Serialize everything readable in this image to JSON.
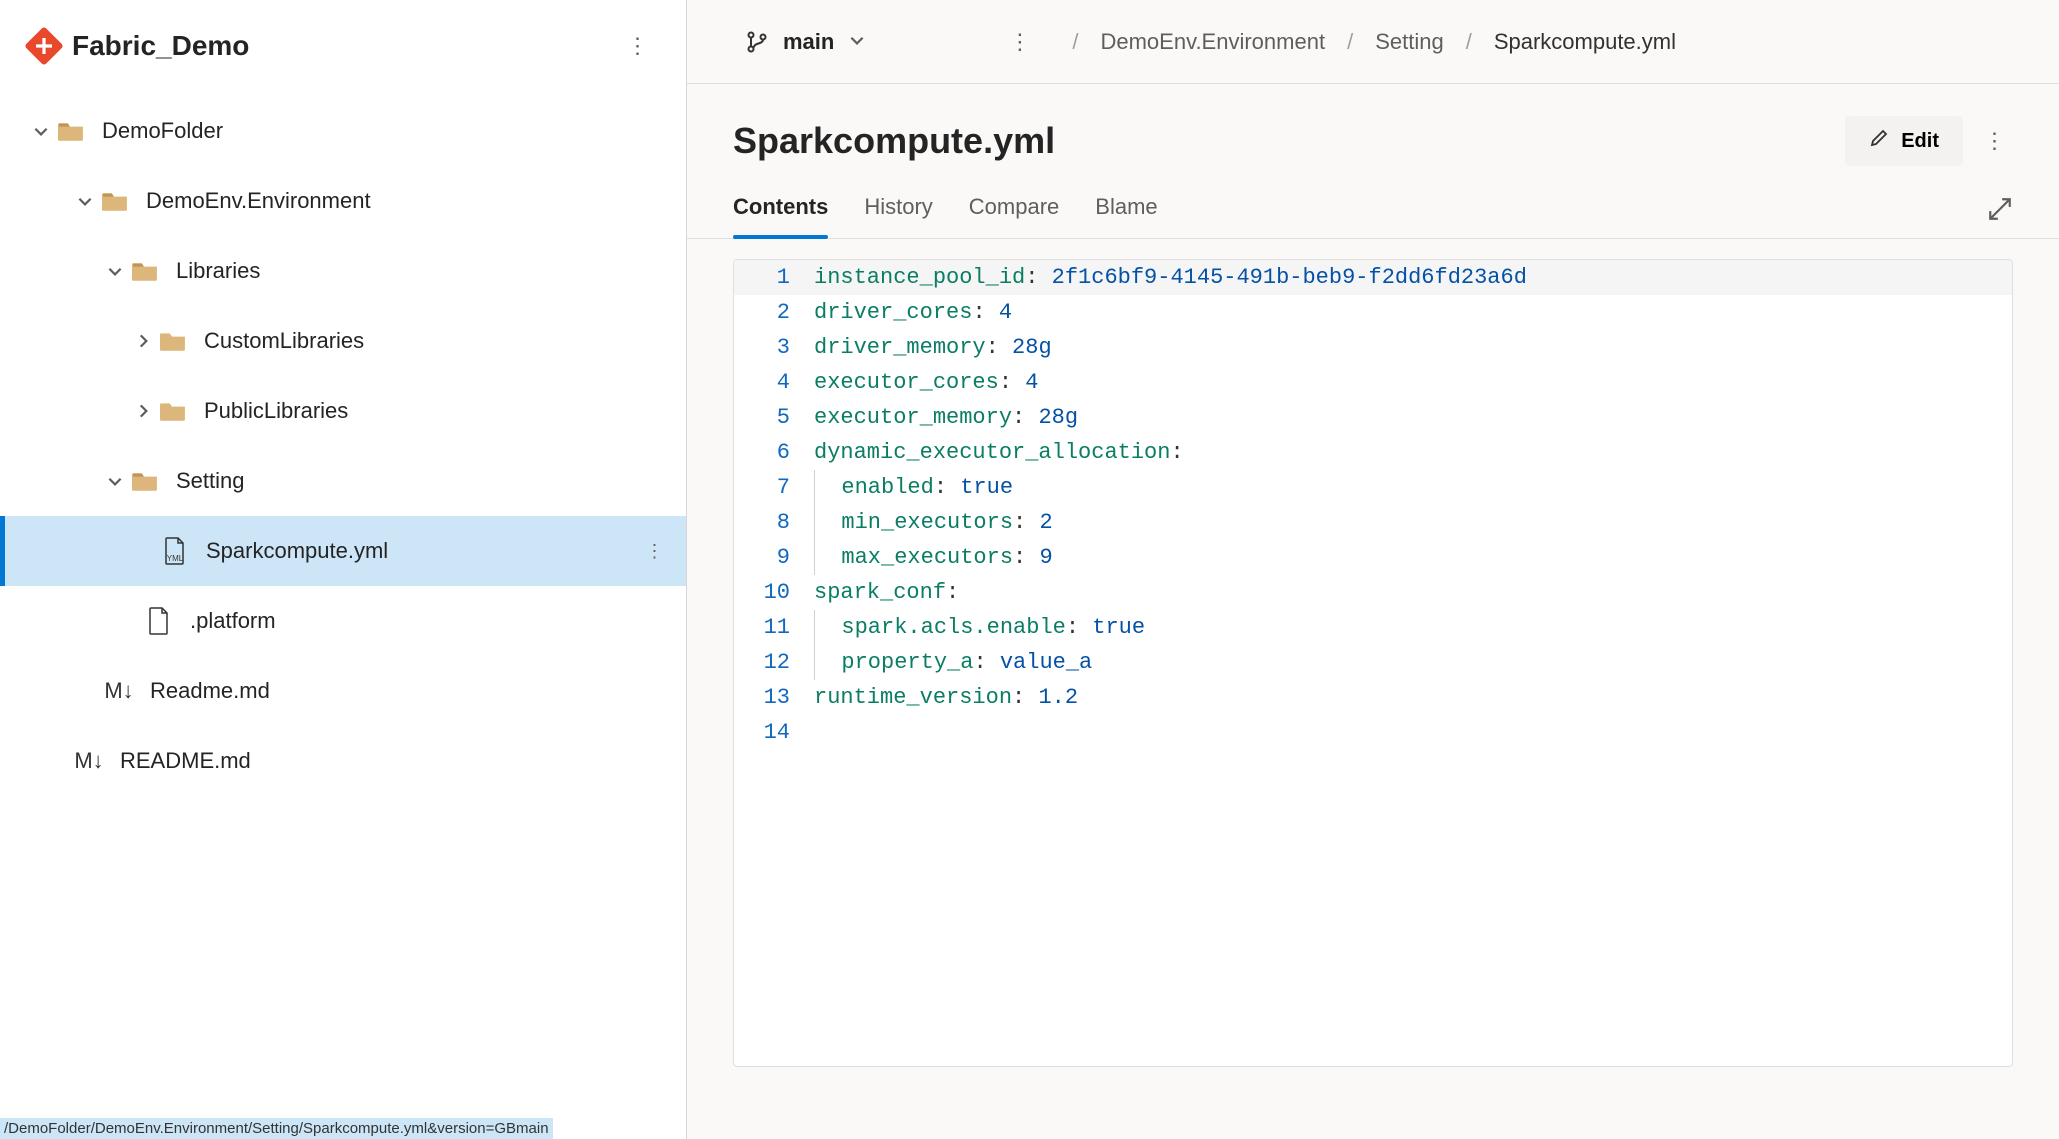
{
  "repo": {
    "name": "Fabric_Demo"
  },
  "tree": {
    "root": {
      "label": "DemoFolder"
    },
    "env": {
      "label": "DemoEnv.Environment"
    },
    "libraries": {
      "label": "Libraries"
    },
    "custom": {
      "label": "CustomLibraries"
    },
    "public": {
      "label": "PublicLibraries"
    },
    "setting": {
      "label": "Setting"
    },
    "sparkcompute": {
      "label": "Sparkcompute.yml"
    },
    "platform": {
      "label": ".platform"
    },
    "readme_inner": {
      "label": "Readme.md"
    },
    "readme_root": {
      "label": "README.md"
    }
  },
  "branch": {
    "name": "main"
  },
  "breadcrumbs": {
    "0": "DemoEnv.Environment",
    "1": "Setting",
    "2": "Sparkcompute.yml"
  },
  "file": {
    "title": "Sparkcompute.yml"
  },
  "actions": {
    "edit": "Edit"
  },
  "tabs": {
    "contents": "Contents",
    "history": "History",
    "compare": "Compare",
    "blame": "Blame"
  },
  "code": {
    "lines": [
      {
        "n": "1",
        "tokens": [
          {
            "t": "key",
            "v": "instance_pool_id"
          },
          {
            "t": "sep",
            "v": ": "
          },
          {
            "t": "val",
            "v": "2f1c6bf9-4145-491b-beb9-f2dd6fd23a6d"
          }
        ]
      },
      {
        "n": "2",
        "tokens": [
          {
            "t": "key",
            "v": "driver_cores"
          },
          {
            "t": "sep",
            "v": ": "
          },
          {
            "t": "val",
            "v": "4"
          }
        ]
      },
      {
        "n": "3",
        "tokens": [
          {
            "t": "key",
            "v": "driver_memory"
          },
          {
            "t": "sep",
            "v": ": "
          },
          {
            "t": "val",
            "v": "28g"
          }
        ]
      },
      {
        "n": "4",
        "tokens": [
          {
            "t": "key",
            "v": "executor_cores"
          },
          {
            "t": "sep",
            "v": ": "
          },
          {
            "t": "val",
            "v": "4"
          }
        ]
      },
      {
        "n": "5",
        "tokens": [
          {
            "t": "key",
            "v": "executor_memory"
          },
          {
            "t": "sep",
            "v": ": "
          },
          {
            "t": "val",
            "v": "28g"
          }
        ]
      },
      {
        "n": "6",
        "tokens": [
          {
            "t": "key",
            "v": "dynamic_executor_allocation"
          },
          {
            "t": "sep",
            "v": ":"
          }
        ]
      },
      {
        "n": "7",
        "indent": 1,
        "tokens": [
          {
            "t": "key",
            "v": "enabled"
          },
          {
            "t": "sep",
            "v": ": "
          },
          {
            "t": "val",
            "v": "true"
          }
        ]
      },
      {
        "n": "8",
        "indent": 1,
        "tokens": [
          {
            "t": "key",
            "v": "min_executors"
          },
          {
            "t": "sep",
            "v": ": "
          },
          {
            "t": "val",
            "v": "2"
          }
        ]
      },
      {
        "n": "9",
        "indent": 1,
        "tokens": [
          {
            "t": "key",
            "v": "max_executors"
          },
          {
            "t": "sep",
            "v": ": "
          },
          {
            "t": "val",
            "v": "9"
          }
        ]
      },
      {
        "n": "10",
        "tokens": [
          {
            "t": "key",
            "v": "spark_conf"
          },
          {
            "t": "sep",
            "v": ":"
          }
        ]
      },
      {
        "n": "11",
        "indent": 1,
        "tokens": [
          {
            "t": "key",
            "v": "spark.acls.enable"
          },
          {
            "t": "sep",
            "v": ": "
          },
          {
            "t": "val",
            "v": "true"
          }
        ]
      },
      {
        "n": "12",
        "indent": 1,
        "tokens": [
          {
            "t": "key",
            "v": "property_a"
          },
          {
            "t": "sep",
            "v": ": "
          },
          {
            "t": "val",
            "v": "value_a"
          }
        ]
      },
      {
        "n": "13",
        "tokens": [
          {
            "t": "key",
            "v": "runtime_version"
          },
          {
            "t": "sep",
            "v": ": "
          },
          {
            "t": "val",
            "v": "1.2"
          }
        ]
      },
      {
        "n": "14",
        "tokens": []
      }
    ]
  },
  "status": {
    "text": "/DemoFolder/DemoEnv.Environment/Setting/Sparkcompute.yml&version=GBmain"
  }
}
